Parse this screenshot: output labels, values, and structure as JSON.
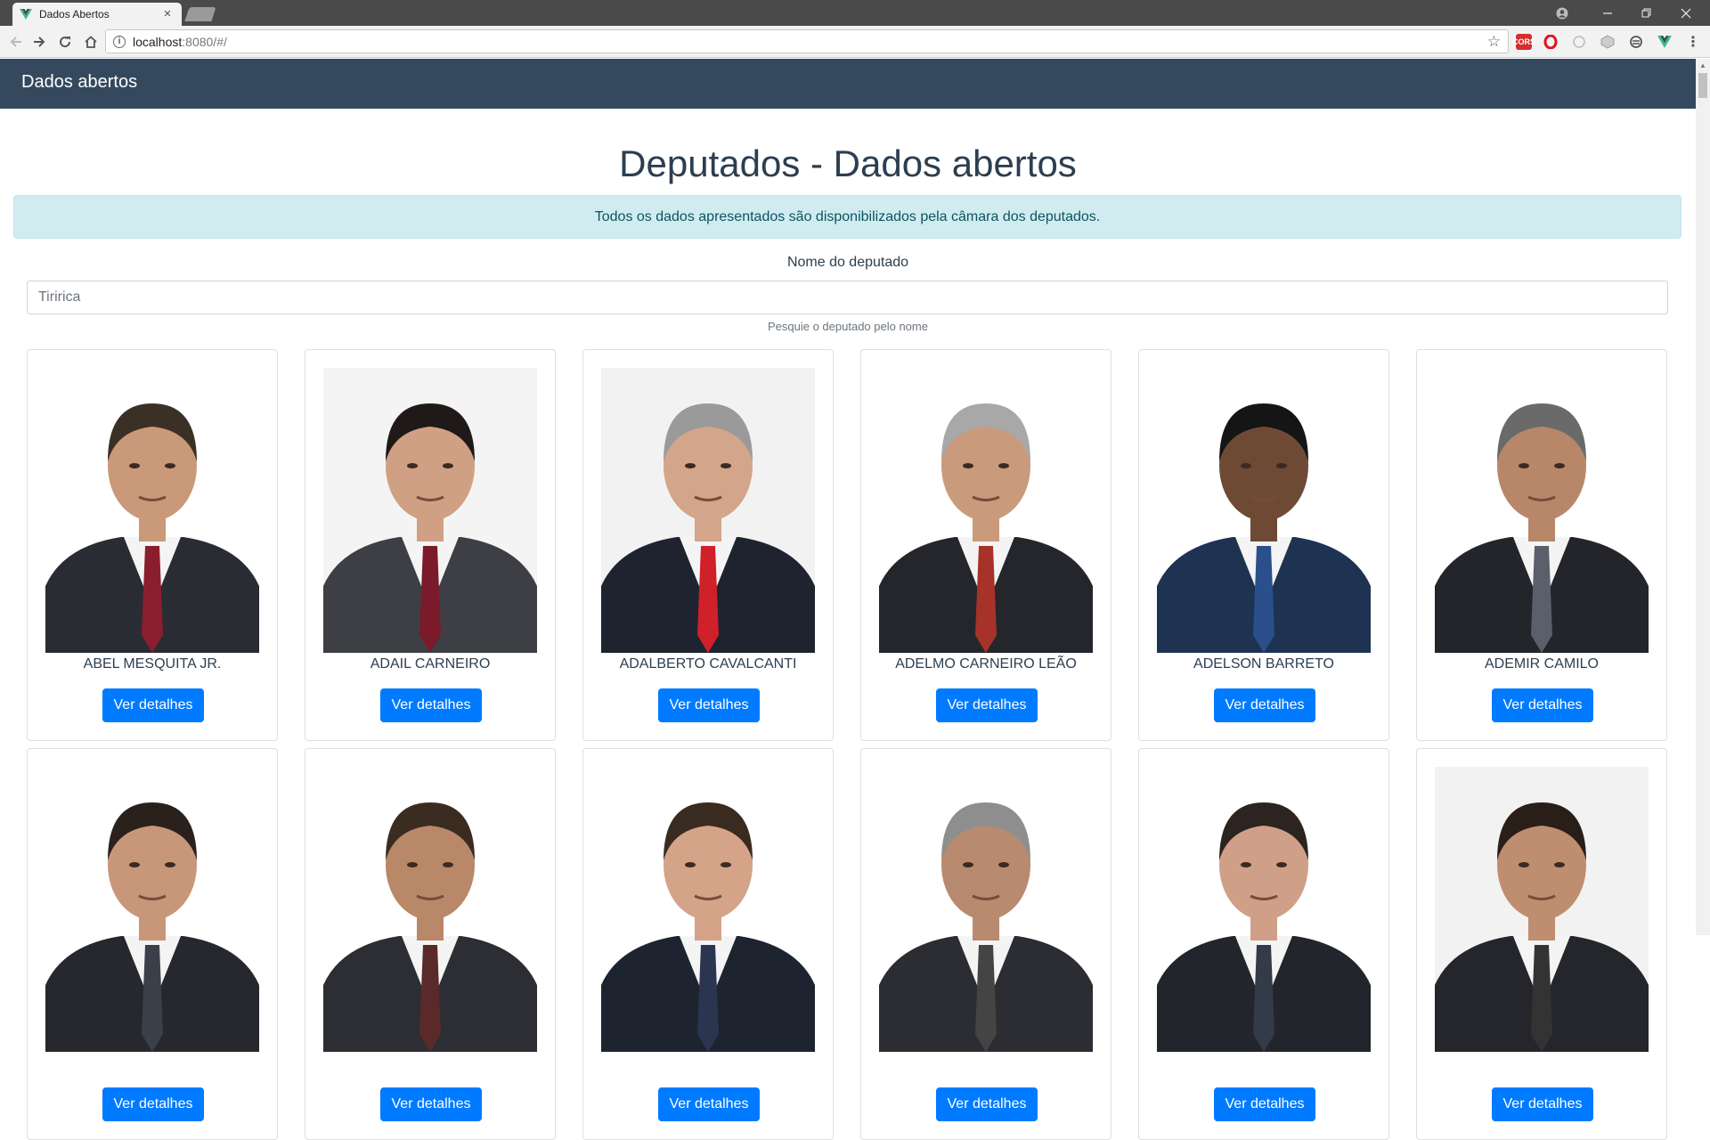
{
  "browser": {
    "tab_title": "Dados Abertos",
    "tab_close": "×",
    "url_host": "localhost",
    "url_rest": ":8080/#/",
    "ext_cors_label": "CORS"
  },
  "app": {
    "brand": "Dados abertos",
    "page_title": "Deputados - Dados abertos",
    "alert": "Todos os dados apresentados são disponibilizados pela câmara dos deputados.",
    "search": {
      "label": "Nome do deputado",
      "placeholder": "Tiririca",
      "value": "",
      "help": "Pesquie o deputado pelo nome"
    },
    "button_label": "Ver detalhes",
    "deputies": [
      {
        "name": "ABEL MESQUITA JR.",
        "suit": "#2a2c33",
        "tie": "#8b1e2e",
        "hair": "#3a3025",
        "skin": "#c9997a",
        "bg": "#ffffff"
      },
      {
        "name": "ADAIL CARNEIRO",
        "suit": "#3d3f44",
        "tie": "#7a1a2a",
        "hair": "#1f1a17",
        "skin": "#d0a084",
        "bg": "#f4f4f4"
      },
      {
        "name": "ADALBERTO CAVALCANTI",
        "suit": "#1f2330",
        "tie": "#d0202a",
        "hair": "#9a9a9a",
        "skin": "#d3a58a",
        "bg": "#f2f2f2"
      },
      {
        "name": "ADELMO CARNEIRO LEÃO",
        "suit": "#24262c",
        "tie": "#a6322a",
        "hair": "#a8a8a8",
        "skin": "#c99a7c",
        "bg": "#ffffff"
      },
      {
        "name": "ADELSON BARRETO",
        "suit": "#1e3352",
        "tie": "#2a4f8a",
        "hair": "#151515",
        "skin": "#6e4a35",
        "bg": "#ffffff"
      },
      {
        "name": "ADEMIR CAMILO",
        "suit": "#23252b",
        "tie": "#5b5f6b",
        "hair": "#6a6a6a",
        "skin": "#b8876a",
        "bg": "#ffffff"
      },
      {
        "name": "",
        "suit": "#26282e",
        "tie": "#3b3f4a",
        "hair": "#2a211c",
        "skin": "#c8977a",
        "bg": "#ffffff"
      },
      {
        "name": "",
        "suit": "#2c2e33",
        "tie": "#5a2a2a",
        "hair": "#3b2c22",
        "skin": "#b98868",
        "bg": "#ffffff"
      },
      {
        "name": "",
        "suit": "#1e2330",
        "tie": "#2c3550",
        "hair": "#3a2b20",
        "skin": "#d4a388",
        "bg": "#ffffff"
      },
      {
        "name": "",
        "suit": "#2b2d33",
        "tie": "#444",
        "hair": "#8e8e8e",
        "skin": "#b88a70",
        "bg": "#ffffff"
      },
      {
        "name": "",
        "suit": "#22252c",
        "tie": "#333a48",
        "hair": "#2c2420",
        "skin": "#cfa087",
        "bg": "#ffffff"
      },
      {
        "name": "",
        "suit": "#24262c",
        "tie": "#333",
        "hair": "#2a1f18",
        "skin": "#bf8e70",
        "bg": "#f2f2f2"
      }
    ]
  }
}
